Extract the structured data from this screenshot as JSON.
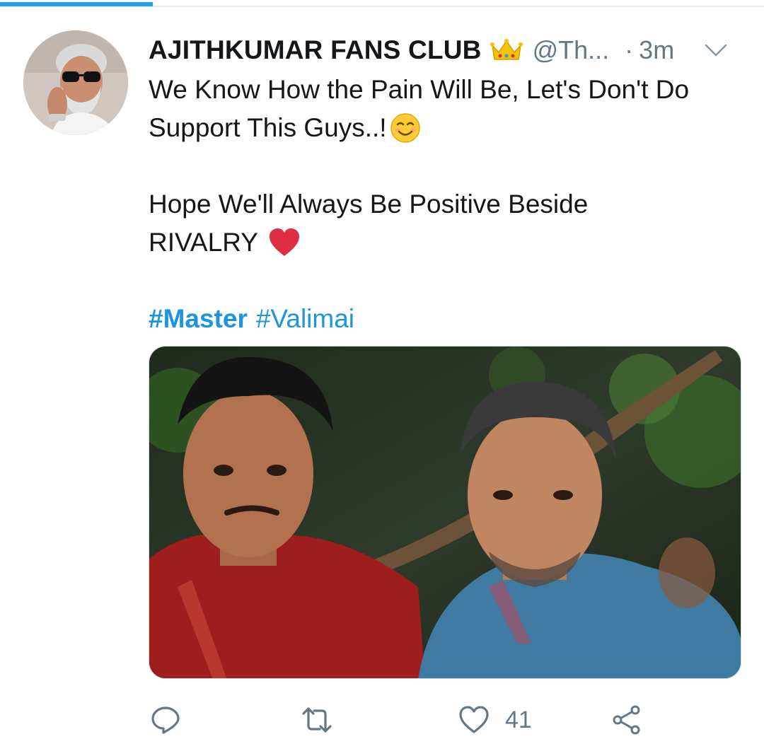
{
  "progress": {
    "fraction": 0.2,
    "color": "#1da1f2"
  },
  "tweet": {
    "display_name": "AJITHKUMAR FANS CLUB",
    "badge": "crown-icon",
    "handle": "@Th...",
    "separator": "·",
    "timestamp": "3m",
    "text_lines": [
      "We Know How the Pain Will Be, Let's Don't Do",
      "Support This Guys..!",
      "Hope We'll Always Be Positive Beside",
      "RIVALRY"
    ],
    "hashtags": [
      "#Master",
      "#Valimai"
    ]
  },
  "actions": {
    "reply_icon": "reply-icon",
    "retweet_icon": "retweet-icon",
    "like_icon": "heart-icon",
    "like_count": "41",
    "share_icon": "share-icon"
  },
  "colors": {
    "link": "#1b95e0",
    "muted": "#657786",
    "text": "#14171a"
  }
}
